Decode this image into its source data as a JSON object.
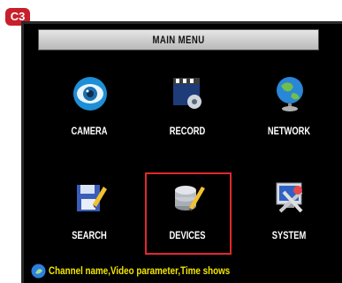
{
  "badge": "C3",
  "menu": {
    "title": "MAIN MENU",
    "items": [
      {
        "label": "CAMERA",
        "icon": "camera-icon"
      },
      {
        "label": "RECORD",
        "icon": "record-icon"
      },
      {
        "label": "NETWORK",
        "icon": "network-globe-icon"
      },
      {
        "label": "SEARCH",
        "icon": "search-icon"
      },
      {
        "label": "DEVICES",
        "icon": "devices-icon",
        "selected": true
      },
      {
        "label": "SYSTEM",
        "icon": "system-icon"
      }
    ]
  },
  "status": {
    "text": "Channel name,Video parameter,Time shows",
    "icon": "info-bulb-icon"
  },
  "colors": {
    "background": "#000000",
    "selection": "#e3262e",
    "status_text": "#f2e600",
    "badge": "#c8202b"
  }
}
